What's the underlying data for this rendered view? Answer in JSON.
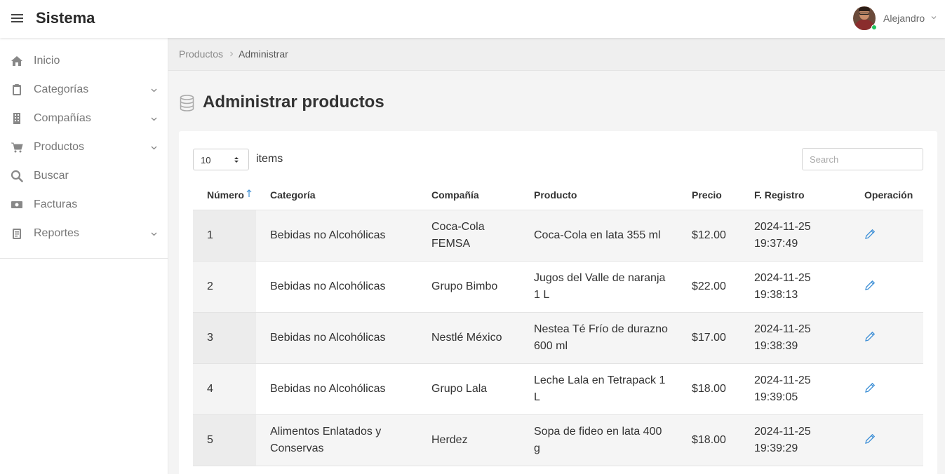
{
  "header": {
    "app_title": "Sistema",
    "user_name": "Alejandro"
  },
  "sidebar": {
    "items": [
      {
        "label": "Inicio",
        "icon": "home-icon",
        "has_submenu": false
      },
      {
        "label": "Categorías",
        "icon": "clipboard-icon",
        "has_submenu": true
      },
      {
        "label": "Compañías",
        "icon": "building-icon",
        "has_submenu": true
      },
      {
        "label": "Productos",
        "icon": "cart-icon",
        "has_submenu": true
      },
      {
        "label": "Buscar",
        "icon": "search-icon",
        "has_submenu": false
      },
      {
        "label": "Facturas",
        "icon": "money-icon",
        "has_submenu": false
      },
      {
        "label": "Reportes",
        "icon": "report-icon",
        "has_submenu": true
      }
    ]
  },
  "breadcrumb": {
    "parent": "Productos",
    "current": "Administrar"
  },
  "page": {
    "title": "Administrar productos",
    "icon": "database-icon"
  },
  "table_controls": {
    "page_size": "10",
    "items_label": "items",
    "search_placeholder": "Search"
  },
  "table": {
    "columns": [
      "Número",
      "Categoría",
      "Compañía",
      "Producto",
      "Precio",
      "F. Registro",
      "Operación"
    ],
    "rows": [
      {
        "numero": "1",
        "categoria": "Bebidas no Alcohólicas",
        "compania": "Coca-Cola FEMSA",
        "producto": "Coca-Cola en lata 355 ml",
        "precio": "$12.00",
        "registro": "2024-11-25 19:37:49"
      },
      {
        "numero": "2",
        "categoria": "Bebidas no Alcohólicas",
        "compania": "Grupo Bimbo",
        "producto": "Jugos del Valle de naranja 1 L",
        "precio": "$22.00",
        "registro": "2024-11-25 19:38:13"
      },
      {
        "numero": "3",
        "categoria": "Bebidas no Alcohólicas",
        "compania": "Nestlé México",
        "producto": "Nestea Té Frío de durazno 600 ml",
        "precio": "$17.00",
        "registro": "2024-11-25 19:38:39"
      },
      {
        "numero": "4",
        "categoria": "Bebidas no Alcohólicas",
        "compania": "Grupo Lala",
        "producto": "Leche Lala en Tetrapack 1 L",
        "precio": "$18.00",
        "registro": "2024-11-25 19:39:05"
      },
      {
        "numero": "5",
        "categoria": "Alimentos Enlatados y Conservas",
        "compania": "Herdez",
        "producto": "Sopa de fideo en lata 400 g",
        "precio": "$18.00",
        "registro": "2024-11-25 19:39:29"
      }
    ]
  },
  "colors": {
    "accent": "#3d8fd6",
    "online": "#22c55e",
    "sidebar_icon": "#888888"
  }
}
